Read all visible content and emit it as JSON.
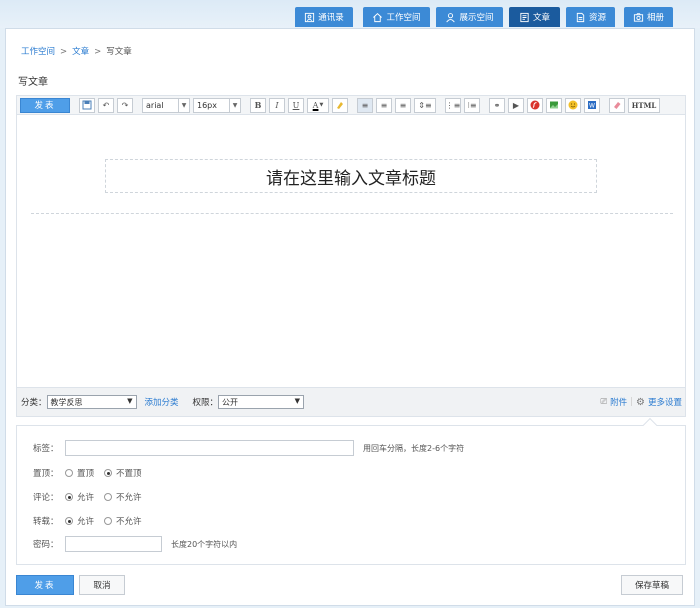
{
  "nav": {
    "tabs": [
      {
        "label": "通讯录",
        "icon": "contacts-icon"
      },
      {
        "label": "工作空间",
        "icon": "home-icon"
      },
      {
        "label": "展示空间",
        "icon": "user-icon"
      },
      {
        "label": "文章",
        "icon": "article-icon",
        "active": true
      },
      {
        "label": "资源",
        "icon": "document-icon"
      },
      {
        "label": "相册",
        "icon": "camera-icon"
      }
    ]
  },
  "breadcrumb": {
    "items": [
      "工作空间",
      "文章",
      "写文章"
    ],
    "separator": ">"
  },
  "page_title": "写文章",
  "toolbar": {
    "publish_label": "发表",
    "font_family": "arial",
    "font_size": "16px",
    "bold": "B",
    "italic": "I",
    "underline": "U",
    "color": "A",
    "html_label": "HTML"
  },
  "editor": {
    "title_placeholder": "请在这里输入文章标题"
  },
  "category": {
    "label": "分类：",
    "value": "教学反思",
    "add_link": "添加分类",
    "permission_label": "权限：",
    "permission_value": "公开",
    "attachment": "附件",
    "more_settings": "更多设置"
  },
  "settings": {
    "tags_label": "标签：",
    "tags_hint": "用回车分隔，长度2-6个字符",
    "top_label": "置顶：",
    "top_options": [
      "置顶",
      "不置顶"
    ],
    "top_selected": 1,
    "comment_label": "评论：",
    "comment_options": [
      "允许",
      "不允许"
    ],
    "comment_selected": 0,
    "repost_label": "转载：",
    "repost_options": [
      "允许",
      "不允许"
    ],
    "repost_selected": 0,
    "password_label": "密码：",
    "password_hint": "长度20个字符以内"
  },
  "actions": {
    "publish": "发表",
    "cancel": "取消",
    "save_draft": "保存草稿"
  },
  "colors": {
    "primary": "#4f9ee8",
    "nav": "#3c8ad6",
    "nav_active": "#1b5b9e",
    "link": "#2a7bd0"
  }
}
